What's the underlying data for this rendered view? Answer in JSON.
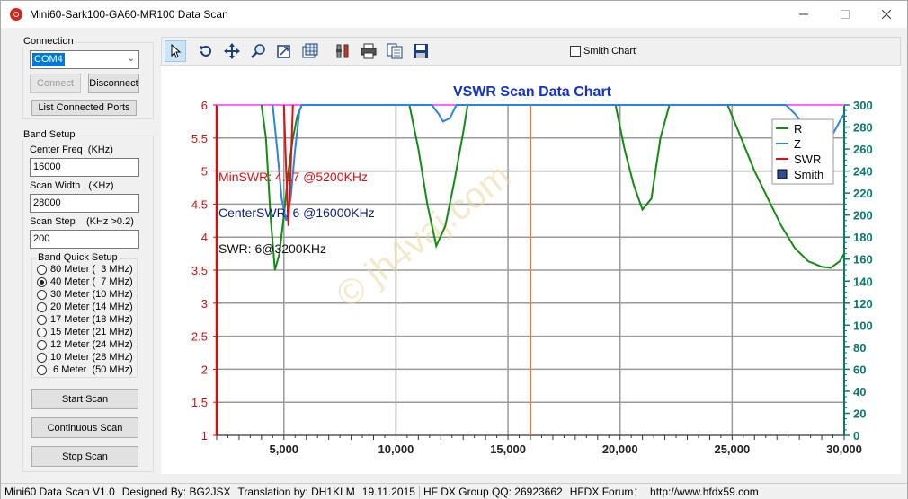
{
  "window": {
    "title": "Mini60-Sark100-GA60-MR100 Data Scan"
  },
  "connection": {
    "group_label": "Connection",
    "port_value": "COM4",
    "connect_label": "Connect",
    "disconnect_label": "Disconnect",
    "list_ports_label": "List Connected Ports"
  },
  "band_setup": {
    "group_label": "Band Setup",
    "center_freq_label": "Center Freq  (KHz)",
    "center_freq_value": "16000",
    "scan_width_label": "Scan Width   (KHz)",
    "scan_width_value": "28000",
    "scan_step_label": "Scan Step    (KHz >0.2)",
    "scan_step_value": "200",
    "quick_setup_label": "Band Quick Setup",
    "bands": [
      {
        "label": "80 Meter (  3 MHz)",
        "selected": false
      },
      {
        "label": "40 Meter (  7 MHz)",
        "selected": true
      },
      {
        "label": "30 Meter (10 MHz)",
        "selected": false
      },
      {
        "label": "20 Meter (14 MHz)",
        "selected": false
      },
      {
        "label": "17 Meter (18 MHz)",
        "selected": false
      },
      {
        "label": "15 Meter (21 MHz)",
        "selected": false
      },
      {
        "label": "12 Meter (24 MHz)",
        "selected": false
      },
      {
        "label": "10 Meter (28 MHz)",
        "selected": false
      },
      {
        "label": " 6 Meter  (50 MHz)",
        "selected": false
      }
    ],
    "start_scan_label": "Start Scan",
    "continuous_scan_label": "Continuous Scan",
    "stop_scan_label": "Stop Scan"
  },
  "toolbar": {
    "tools": [
      "pointer-icon",
      "undo-icon",
      "pan-icon",
      "zoom-icon",
      "zoom-fit-icon",
      "data-table-icon",
      "settings-icon",
      "print-icon",
      "copy-icon",
      "save-icon"
    ],
    "smith_chart_label": "Smith Chart",
    "smith_chart_checked": false
  },
  "chart_data": {
    "type": "line",
    "title": "VSWR Scan Data Chart",
    "xlim": [
      2000,
      30000
    ],
    "ylim_left": [
      1,
      6
    ],
    "ylim_right": [
      0,
      300
    ],
    "x_ticks": [
      5000,
      10000,
      15000,
      20000,
      25000,
      30000
    ],
    "x_tick_labels": [
      "5,000",
      "10,000",
      "15,000",
      "20,000",
      "25,000",
      "30,000"
    ],
    "y_left_ticks": [
      1,
      1.5,
      2,
      2.5,
      3,
      3.5,
      4,
      4.5,
      5,
      5.5,
      6
    ],
    "y_left_tick_labels": [
      "1",
      "1.5",
      "2",
      "2.5",
      "3",
      "3.5",
      "4",
      "4.5",
      "5",
      "5.5",
      "6"
    ],
    "y_right_ticks": [
      0,
      20,
      40,
      60,
      80,
      100,
      120,
      140,
      160,
      180,
      200,
      220,
      240,
      260,
      280,
      300
    ],
    "y_right_tick_labels": [
      "0",
      "20",
      "40",
      "60",
      "80",
      "100",
      "120",
      "140",
      "160",
      "180",
      "200",
      "220",
      "240",
      "260",
      "280",
      "300"
    ],
    "grid": true,
    "legend_position": "top-right",
    "series": [
      {
        "name": "R",
        "color": "#138a13",
        "axis": "right",
        "x": [
          4000,
          4200,
          4400,
          4600,
          4800,
          5000,
          5200,
          5400,
          5600,
          5800,
          10600,
          11000,
          11400,
          11800,
          12200,
          12600,
          13000,
          13200,
          19800,
          20200,
          20600,
          21000,
          21400,
          21800,
          22200,
          24800,
          25400,
          26000,
          26600,
          27200,
          27800,
          28400,
          29000,
          29400,
          29800,
          30000
        ],
        "y": [
          300,
          270,
          200,
          150,
          165,
          200,
          240,
          270,
          290,
          300,
          300,
          260,
          210,
          172,
          190,
          230,
          275,
          300,
          300,
          260,
          228,
          205,
          215,
          270,
          300,
          300,
          270,
          240,
          215,
          190,
          170,
          158,
          153,
          152,
          158,
          165
        ]
      },
      {
        "name": "Z",
        "color": "#2a83e6",
        "axis": "right",
        "x": [
          4500,
          4700,
          4900,
          5100,
          5300,
          5500,
          5700,
          5800,
          11600,
          11900,
          12100,
          12400,
          12700,
          27400,
          27800,
          28200,
          28600,
          29000,
          29400,
          29800,
          30000
        ],
        "y": [
          300,
          260,
          215,
          195,
          215,
          260,
          295,
          300,
          300,
          292,
          285,
          288,
          300,
          300,
          292,
          282,
          270,
          262,
          270,
          285,
          292
        ]
      },
      {
        "name": "SWR",
        "color": "#e01010",
        "axis": "left",
        "x": [
          5000,
          5100,
          5200,
          5300,
          5400
        ],
        "y": [
          6,
          5.0,
          4.17,
          5.0,
          6
        ]
      },
      {
        "name": "Smith",
        "color": "#2f4f8f",
        "axis": "left",
        "x": [],
        "y": []
      }
    ],
    "center_marker_x": 16000,
    "top_reference_y": 6,
    "annotations": [
      {
        "text": "MinSWR: 4.17 @5200KHz",
        "color": "#e01010"
      },
      {
        "text": "CenterSWR: 6 @16000KHz",
        "color": "#10207a"
      },
      {
        "text": "SWR: 6@3200KHz",
        "color": "#111111"
      }
    ],
    "watermark": "© jh4vaj.com"
  },
  "status": {
    "version": "Mini60 Data Scan V1.0",
    "designed_by": "Designed By: BG2JSX",
    "translation": "Translation by: DH1KLM",
    "date": "19.11.2015",
    "group": "HF DX Group QQ: 26923662",
    "forum": "HFDX Forum：  http://www.hfdx59.com"
  }
}
